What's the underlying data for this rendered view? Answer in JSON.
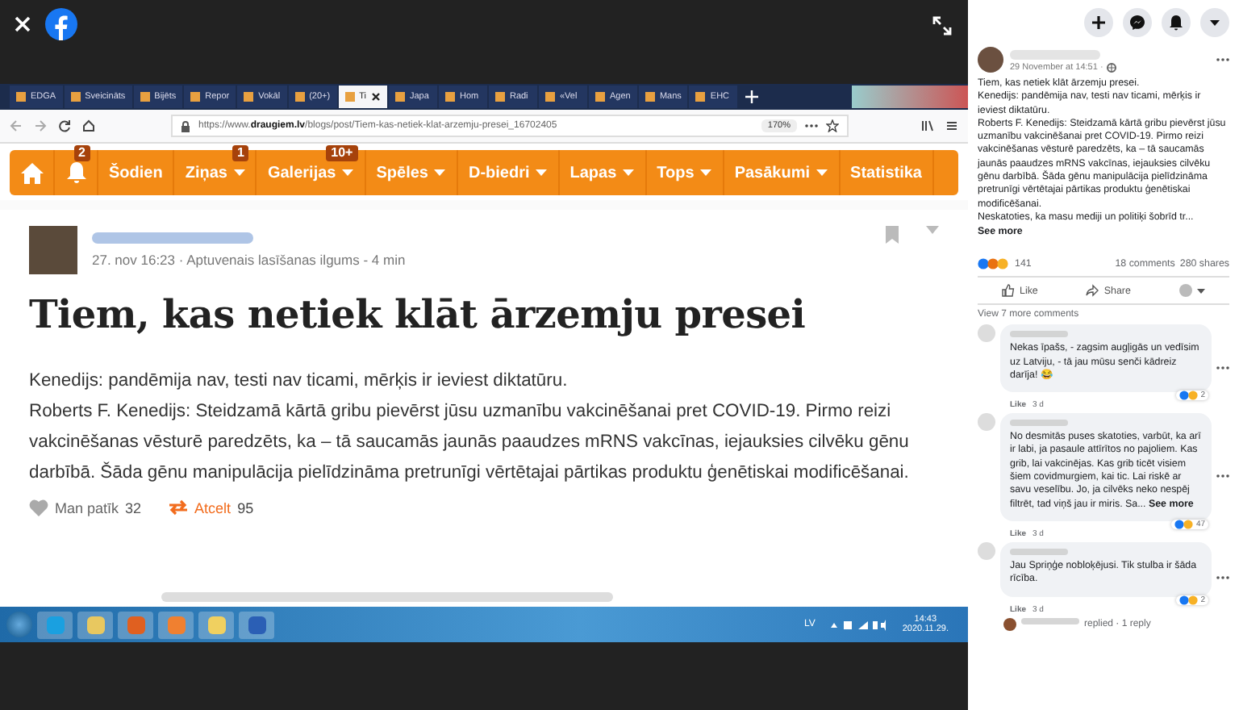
{
  "browser": {
    "tabs": [
      {
        "label": "EDGA",
        "selected": false
      },
      {
        "label": "Sveicināts",
        "selected": false
      },
      {
        "label": "Bijēts",
        "selected": false
      },
      {
        "label": "Repor",
        "selected": false
      },
      {
        "label": "Vokāl",
        "selected": false
      },
      {
        "label": "(20+)",
        "selected": false
      },
      {
        "label": "Ti",
        "selected": true
      },
      {
        "label": "Japa",
        "selected": false
      },
      {
        "label": "Hom",
        "selected": false
      },
      {
        "label": "Radi",
        "selected": false
      },
      {
        "label": "«Vel",
        "selected": false
      },
      {
        "label": "Agen",
        "selected": false
      },
      {
        "label": "Mans",
        "selected": false
      },
      {
        "label": "EHC",
        "selected": false
      }
    ],
    "url": "https://www.**draugiem.lv**/blogs/post/Tiem-kas-netiek-klat-arzemju-presei_16702405",
    "zoom": "170%"
  },
  "nav": [
    {
      "kind": "home",
      "caret": false
    },
    {
      "kind": "bell",
      "badge": "2",
      "caret": false
    },
    {
      "kind": "text",
      "label": "Šodien",
      "caret": false
    },
    {
      "kind": "text",
      "label": "Ziņas",
      "badge": "1",
      "caret": true
    },
    {
      "kind": "text",
      "label": "Galerijas",
      "badge": "10+",
      "caret": true
    },
    {
      "kind": "text",
      "label": "Spēles",
      "caret": true
    },
    {
      "kind": "text",
      "label": "D-biedri",
      "caret": true
    },
    {
      "kind": "text",
      "label": "Lapas",
      "caret": true
    },
    {
      "kind": "text",
      "label": "Tops",
      "caret": true
    },
    {
      "kind": "text",
      "label": "Pasākumi",
      "caret": true
    },
    {
      "kind": "text",
      "label": "Statistika",
      "caret": false
    }
  ],
  "article": {
    "meta": "27. nov 16:23 · Aptuvenais lasīšanas ilgums - 4 min",
    "title": "Tiem, kas netiek klāt ārzemju presei",
    "paragraphs": [
      "Kenedijs: pandēmija nav, testi nav ticami, mērķis ir ieviest diktatūru.",
      "Roberts F. Kenedijs: Steidzamā kārtā gribu pievērst jūsu uzmanību vakcinēšanai pret COVID-19. Pirmo reizi vakcinēšanas vēsturē paredzēts, ka – tā saucamās jaunās paaudzes mRNS vakcīnas, iejauksies cilvēku gēnu darbībā. Šāda gēnu manipulācija pielīdzināma pretrunīgi vērtētajai pārtikas produktu ģenētiskai modificēšanai."
    ],
    "like": "Man patīk",
    "like_count": "32",
    "share": "Atcelt",
    "share_count": "95"
  },
  "taskbar": {
    "language": "LV",
    "time": "14:43",
    "date": "2020.11.29."
  },
  "post": {
    "time": "29 November at 14:51 ·",
    "lines": [
      "Tiem, kas netiek klāt ārzemju presei.",
      "Kenedijs: pandēmija nav, testi nav ticami, mērķis ir ieviest diktatūru.",
      "Roberts F. Kenedijs: Steidzamā kārtā gribu pievērst jūsu uzmanību vakcinēšanai pret COVID-19. Pirmo reizi vakcinēšanas vēsturē paredzēts, ka – tā saucamās jaunās paaudzes mRNS vakcīnas, iejauksies cilvēku gēnu darbībā. Šāda gēnu manipulācija pielīdzināma pretrunīgi vērtētajai pārtikas produktu ģenētiskai modificēšanai.",
      "Neskatoties, ka masu mediji un politiķi šobrīd tr..."
    ],
    "see_more": "See more",
    "reactions": "141",
    "comments": "18 comments",
    "shares": "280 shares",
    "like": "Like",
    "share": "Share"
  },
  "view_more": "View 7 more comments",
  "comments": [
    {
      "text": "Nekas īpašs, - zagsim augļigās un vedīsim uz Latviju, - tā jau mūsu senči kādreiz darīja! 😂",
      "like": "Like",
      "age": "3 d",
      "reactions": "2"
    },
    {
      "text": "No desmitās puses skatoties, varbūt, ka arī ir labi, ja pasaule attīrītos no pajoliem. Kas grib, lai vakcinējas. Kas grib ticēt visiem šiem covidmurgiem, kai tic. Lai riskē ar savu veselību. Jo, ja cilvēks neko nespēj filtrēt, tad viņš jau ir miris. Sa...",
      "see_more": "See more",
      "like": "Like",
      "age": "3 d",
      "reactions": "47"
    },
    {
      "text": "Jau Spriņģe nobloķējusi. Tik stulba ir šāda rīcība.",
      "like": "Like",
      "age": "3 d",
      "reactions": "2"
    }
  ],
  "reply_line": "replied · 1 reply"
}
